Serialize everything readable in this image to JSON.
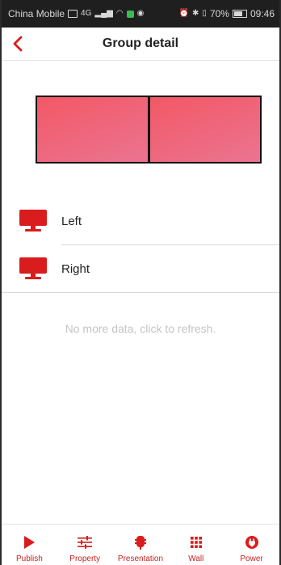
{
  "status_bar": {
    "carrier": "China Mobile",
    "network": "4G",
    "battery_percent": "70%",
    "time": "09:46"
  },
  "header": {
    "title": "Group detail"
  },
  "wall": {
    "tiles": 2,
    "tile_color_start": "#f35865",
    "tile_color_end": "#ea7491"
  },
  "devices": [
    {
      "label": "Left",
      "icon": "monitor-icon"
    },
    {
      "label": "Right",
      "icon": "monitor-icon"
    }
  ],
  "refresh_hint": "No more data, click to refresh.",
  "bottom_nav": [
    {
      "label": "Publish",
      "icon": "play-icon"
    },
    {
      "label": "Property",
      "icon": "sliders-icon"
    },
    {
      "label": "Presentation",
      "icon": "presentation-icon"
    },
    {
      "label": "Wall",
      "icon": "grid-icon"
    },
    {
      "label": "Power",
      "icon": "power-plug-icon"
    }
  ],
  "colors": {
    "accent": "#d91c1c",
    "label": "#cc1f1f",
    "hint": "#c4c4c4"
  }
}
